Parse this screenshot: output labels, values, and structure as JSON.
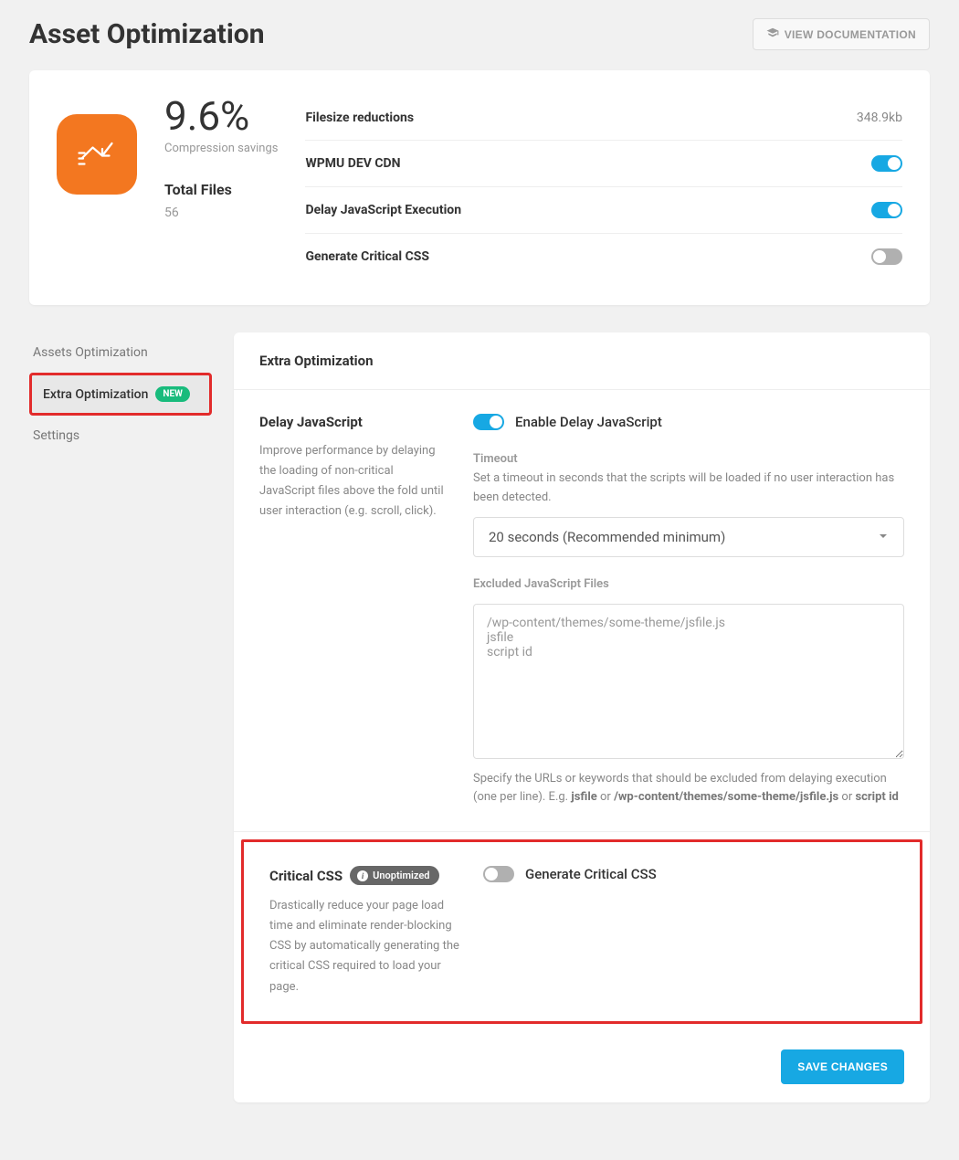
{
  "header": {
    "title": "Asset Optimization",
    "doc_button": "VIEW DOCUMENTATION"
  },
  "summary": {
    "pct": "9.6%",
    "pct_label": "Compression savings",
    "total_label": "Total Files",
    "total_value": "56",
    "rows": [
      {
        "label": "Filesize reductions",
        "value": "348.9kb",
        "type": "text"
      },
      {
        "label": "WPMU DEV CDN",
        "type": "toggle",
        "on": true
      },
      {
        "label": "Delay JavaScript Execution",
        "type": "toggle",
        "on": true
      },
      {
        "label": "Generate Critical CSS",
        "type": "toggle",
        "on": false
      }
    ]
  },
  "sidebar": {
    "items": [
      {
        "label": "Assets Optimization",
        "active": false
      },
      {
        "label": "Extra Optimization",
        "active": true,
        "badge": "NEW"
      },
      {
        "label": "Settings",
        "active": false
      }
    ]
  },
  "panel": {
    "title": "Extra Optimization",
    "delay_js": {
      "title": "Delay JavaScript",
      "desc": "Improve performance by delaying the loading of non-critical JavaScript files above the fold until user interaction (e.g. scroll, click).",
      "enable_label": "Enable Delay JavaScript",
      "enabled": true,
      "timeout_label": "Timeout",
      "timeout_help": "Set a timeout in seconds that the scripts will be loaded if no user interaction has been detected.",
      "timeout_value": "20 seconds (Recommended minimum)",
      "excluded_label": "Excluded JavaScript Files",
      "excluded_placeholder": "/wp-content/themes/some-theme/jsfile.js\njsfile\nscript id",
      "excluded_help_prefix": "Specify the URLs or keywords that should be excluded from delaying execution (one per line). E.g. ",
      "excluded_help_b1": "jsfile",
      "excluded_help_mid": " or ",
      "excluded_help_b2": "/wp-content/themes/some-theme/jsfile.js",
      "excluded_help_mid2": " or ",
      "excluded_help_b3": "script id"
    },
    "critical_css": {
      "title": "Critical CSS",
      "badge": "Unoptimized",
      "desc": "Drastically reduce your page load time and eliminate render-blocking CSS by automatically generating the critical CSS required to load your page.",
      "enable_label": "Generate Critical CSS",
      "enabled": false
    },
    "save_button": "SAVE CHANGES"
  }
}
